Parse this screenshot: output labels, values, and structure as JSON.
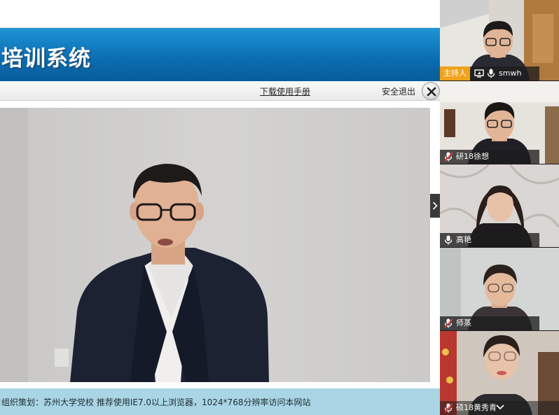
{
  "header": {
    "title": "培训系统"
  },
  "toolbar": {
    "manual_link": "下载使用手册",
    "logout": "安全退出"
  },
  "footer": {
    "text": "组织策划：苏州大学党校 推荐使用IE7.0以上浏览器，1024*768分辨率访问本网站"
  },
  "participants": [
    {
      "name": "smwh",
      "role": "主持人",
      "mic": "on",
      "screen_share": true
    },
    {
      "name": "研18徐想",
      "mic": "muted"
    },
    {
      "name": "高艳",
      "mic": "on"
    },
    {
      "name": "师蒸",
      "mic": "muted"
    },
    {
      "name": "硕18黄秀青",
      "mic": "muted",
      "expand_icon": "chevron-down-icon"
    }
  ],
  "colors": {
    "banner": "#0b6fb4",
    "host_badge": "#f0a21b",
    "footer": "#a9d5e4",
    "panel": "#1b1b1b"
  }
}
